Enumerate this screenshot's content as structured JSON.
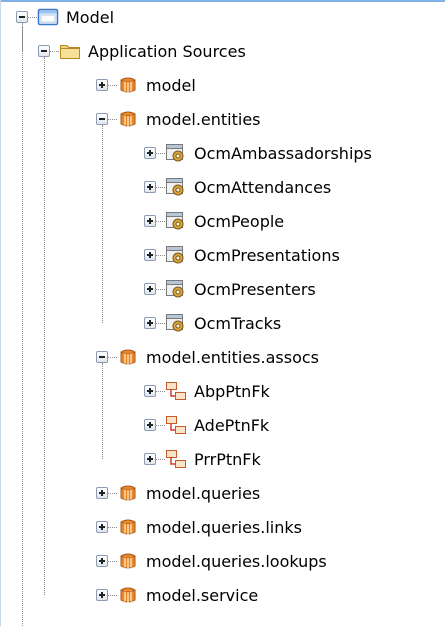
{
  "tree": {
    "root": {
      "label": "Model",
      "icon": "project-icon",
      "expanded": true,
      "children": [
        {
          "label": "Application Sources",
          "icon": "folder-icon",
          "expanded": true,
          "children": [
            {
              "label": "model",
              "icon": "package-icon",
              "expanded": false
            },
            {
              "label": "model.entities",
              "icon": "package-icon",
              "expanded": true,
              "children": [
                {
                  "label": "OcmAmbassadorships",
                  "icon": "entity-icon",
                  "expanded": false
                },
                {
                  "label": "OcmAttendances",
                  "icon": "entity-icon",
                  "expanded": false
                },
                {
                  "label": "OcmPeople",
                  "icon": "entity-icon",
                  "expanded": false
                },
                {
                  "label": "OcmPresentations",
                  "icon": "entity-icon",
                  "expanded": false
                },
                {
                  "label": "OcmPresenters",
                  "icon": "entity-icon",
                  "expanded": false
                },
                {
                  "label": "OcmTracks",
                  "icon": "entity-icon",
                  "expanded": false
                }
              ]
            },
            {
              "label": "model.entities.assocs",
              "icon": "package-icon",
              "expanded": true,
              "children": [
                {
                  "label": "AbpPtnFk",
                  "icon": "association-icon",
                  "expanded": false
                },
                {
                  "label": "AdePtnFk",
                  "icon": "association-icon",
                  "expanded": false
                },
                {
                  "label": "PrrPtnFk",
                  "icon": "association-icon",
                  "expanded": false
                }
              ]
            },
            {
              "label": "model.queries",
              "icon": "package-icon",
              "expanded": false
            },
            {
              "label": "model.queries.links",
              "icon": "package-icon",
              "expanded": false
            },
            {
              "label": "model.queries.lookups",
              "icon": "package-icon",
              "expanded": false
            },
            {
              "label": "model.service",
              "icon": "package-icon",
              "expanded": false
            }
          ]
        }
      ]
    }
  },
  "colors": {
    "top_border": "#7fb0e6",
    "connector": "#8c8c8c",
    "package": "#d97b1f",
    "folder": "#f2d37a",
    "project": "#3a78c9"
  }
}
